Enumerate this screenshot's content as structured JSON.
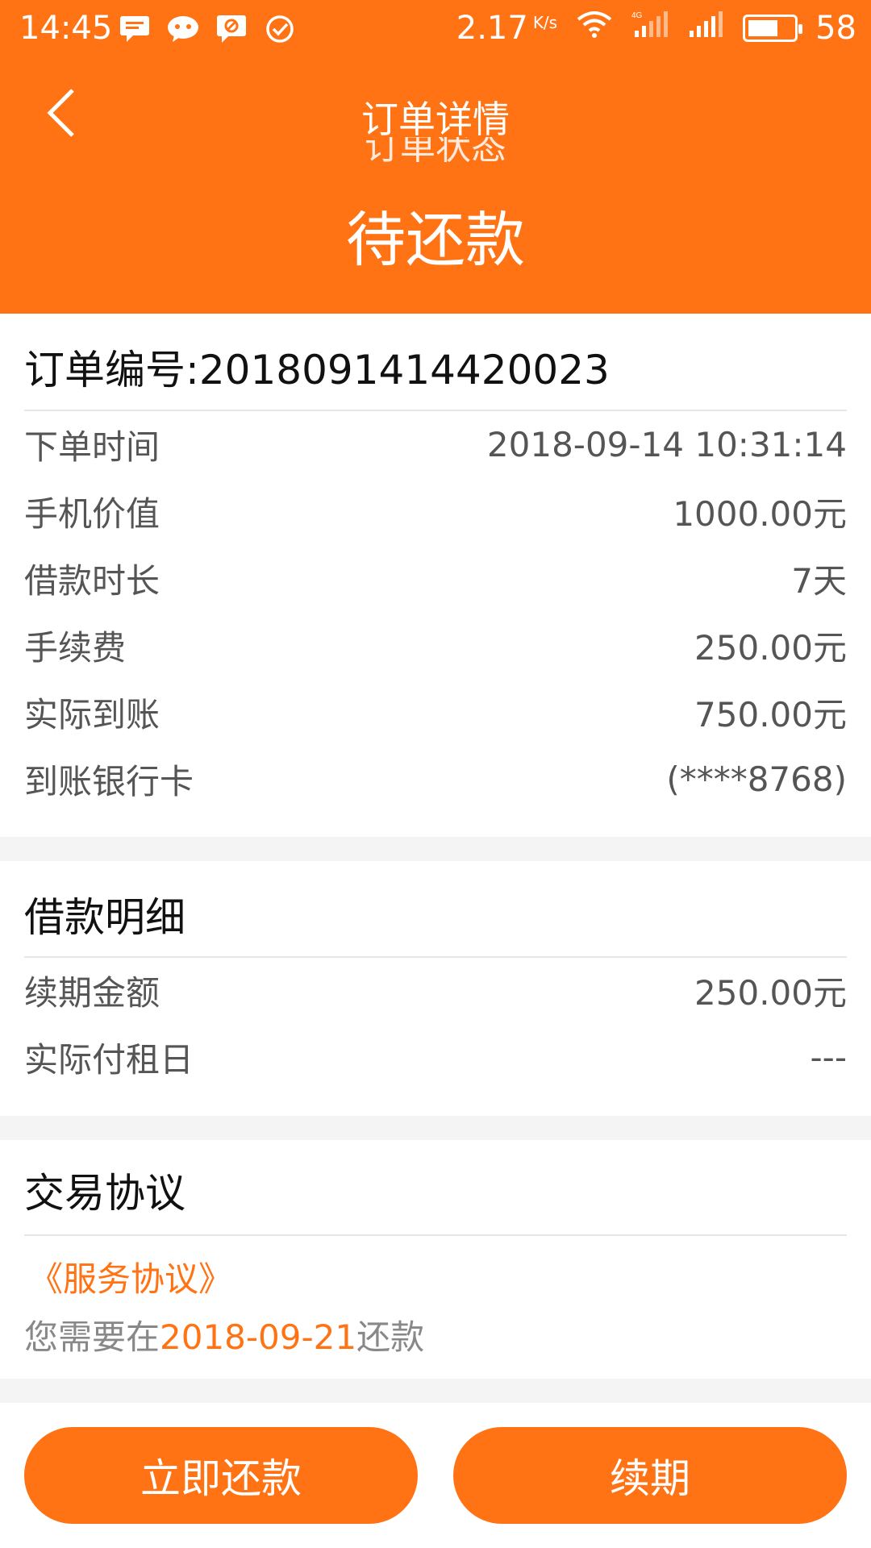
{
  "status_bar": {
    "time": "14:45",
    "speed": "2.17",
    "speed_unit": "K/s",
    "network": "4G",
    "battery": "58"
  },
  "header": {
    "title": "订单详情",
    "status_label_partial": "订单状态",
    "status": "待还款"
  },
  "order": {
    "number_label": "订单编号:",
    "number": "2018091414420023",
    "rows": [
      {
        "label": "下单时间",
        "value": "2018-09-14 10:31:14"
      },
      {
        "label": "手机价值",
        "value": "1000.00元"
      },
      {
        "label": "借款时长",
        "value": "7天"
      },
      {
        "label": "手续费",
        "value": "250.00元"
      },
      {
        "label": "实际到账",
        "value": "750.00元"
      },
      {
        "label": "到账银行卡",
        "value": "(****8768)"
      }
    ]
  },
  "loan_detail": {
    "title": "借款明细",
    "rows": [
      {
        "label": "续期金额",
        "value": "250.00元"
      },
      {
        "label": "实际付租日",
        "value": "---"
      }
    ]
  },
  "agreement": {
    "title": "交易协议",
    "link": "《服务协议》",
    "notice_prefix": "您需要在",
    "notice_date": "2018-09-21",
    "notice_suffix": "还款"
  },
  "actions": {
    "repay_now": "立即还款",
    "renew": "续期"
  },
  "colors": {
    "accent": "#ff7314",
    "background": "#f4f4f4"
  }
}
